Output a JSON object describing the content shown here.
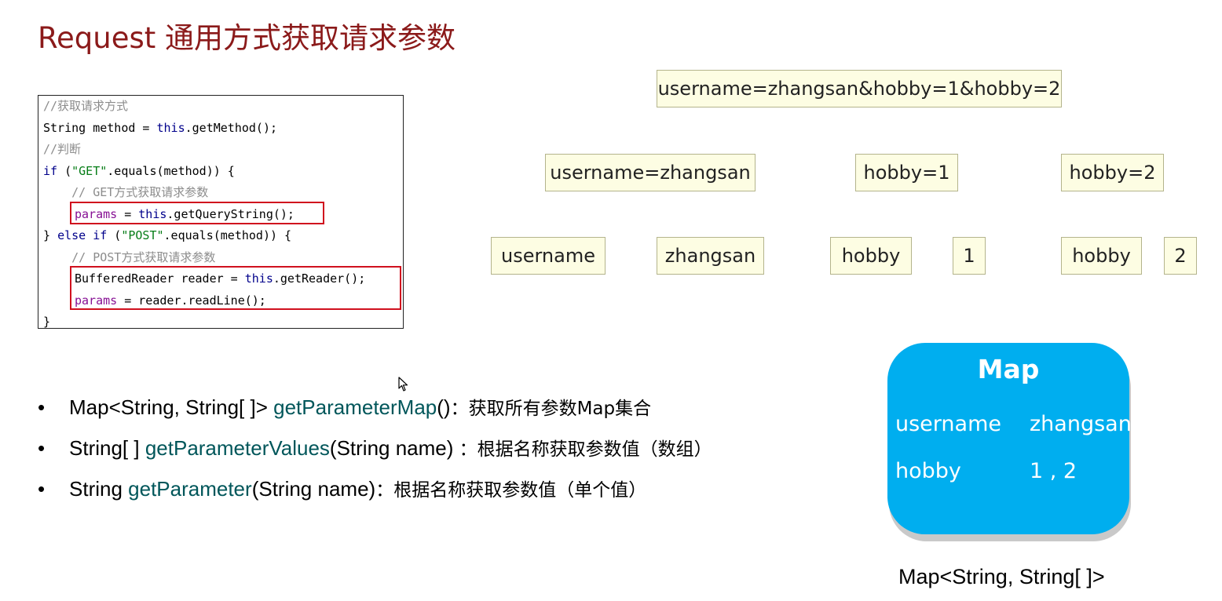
{
  "title": "Request 通用方式获取请求参数",
  "code": {
    "l1": "//获取请求方式",
    "l2a": "String method = ",
    "l2b": "this",
    "l2c": ".getMethod();",
    "l3": "//判断",
    "l4a": "if",
    "l4b": " (",
    "l4c": "\"GET\"",
    "l4d": ".equals(method)) {",
    "l5": "    // GET方式获取请求参数",
    "l6a": "params",
    "l6b": " = ",
    "l6c": "this",
    "l6d": ".getQueryString();",
    "l7a": "} ",
    "l7b": "else if",
    "l7c": " (",
    "l7d": "\"POST\"",
    "l7e": ".equals(method)) {",
    "l8": "    // POST方式获取请求参数",
    "l9a": "BufferedReader reader = ",
    "l9b": "this",
    "l9c": ".getReader();",
    "l10a": "params",
    "l10b": " = reader.readLine();",
    "l11": "}"
  },
  "split": {
    "full": "username=zhangsan&hobby=1&hobby=2",
    "pair1": "username=zhangsan",
    "pair2": "hobby=1",
    "pair3": "hobby=2",
    "k1": "username",
    "v1": "zhangsan",
    "k2": "hobby",
    "v2": "1",
    "k3": "hobby",
    "v3": "2"
  },
  "bullets": [
    {
      "dot": "•",
      "pre": "Map<String, String[ ]> ",
      "method": "getParameterMap",
      "post": "()",
      "desc": "：获取所有参数Map集合"
    },
    {
      "dot": "•",
      "pre": "String[ ] ",
      "method": "getParameterValues",
      "post": "(String name) ",
      "desc": "：根据名称获取参数值（数组）"
    },
    {
      "dot": "•",
      "pre": "String ",
      "method": "getParameter",
      "post": "(String name)",
      "desc": "：根据名称获取参数值（单个值）"
    }
  ],
  "map": {
    "title": "Map",
    "rows": [
      {
        "key": "username",
        "value": "zhangsan"
      },
      {
        "key": "hobby",
        "value": "1 , 2"
      }
    ],
    "caption": "Map<String, String[ ]>"
  },
  "colors": {
    "title": "#8b1a1a",
    "map_bg": "#00aeef",
    "highlight": "#d0101e",
    "method": "#00565a",
    "box_bg": "#fdfde3"
  }
}
